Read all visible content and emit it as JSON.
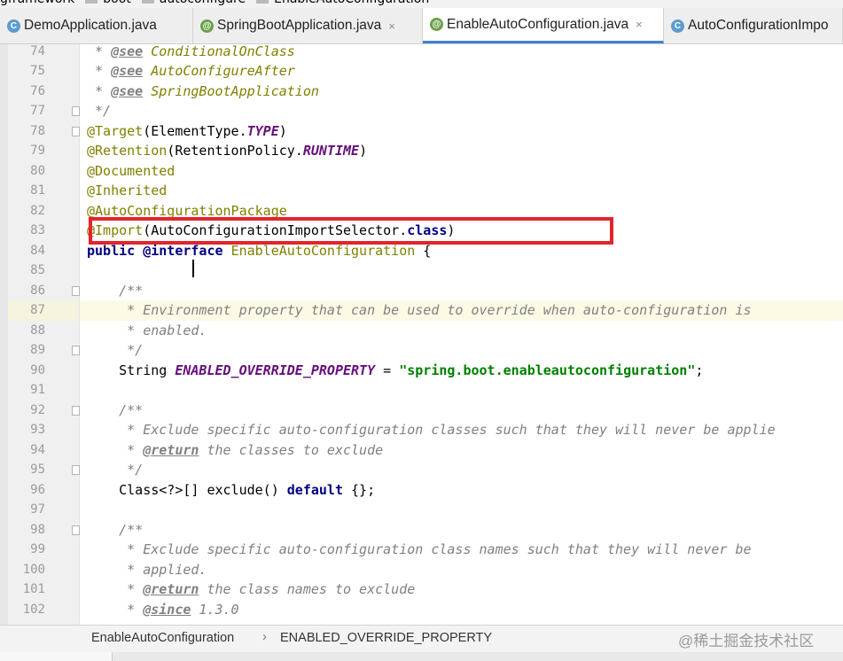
{
  "breadcrumb": {
    "items": [
      "gframework",
      "boot",
      "autoconfigure",
      "EnableAutoConfiguration"
    ]
  },
  "tabs": [
    {
      "label": "DemoApplication.java",
      "icon": "class-icon",
      "closable": false
    },
    {
      "label": "SpringBootApplication.java",
      "icon": "annotation-icon",
      "closable": true
    },
    {
      "label": "EnableAutoConfiguration.java",
      "icon": "annotation-icon",
      "closable": true,
      "active": true
    },
    {
      "label": "AutoConfigurationImpo",
      "icon": "class-icon",
      "closable": false
    }
  ],
  "tab_close_glyph": "×",
  "code_lines": [
    {
      "num": "74",
      "tokens": [
        {
          "t": " * ",
          "s": "c"
        },
        {
          "t": "@see",
          "s": "tag"
        },
        {
          "t": " ",
          "s": "c"
        },
        {
          "t": "ConditionalOnClass",
          "s": "ref"
        }
      ]
    },
    {
      "num": "75",
      "tokens": [
        {
          "t": " * ",
          "s": "c"
        },
        {
          "t": "@see",
          "s": "tag"
        },
        {
          "t": " ",
          "s": "c"
        },
        {
          "t": "AutoConfigureAfter",
          "s": "ref"
        }
      ]
    },
    {
      "num": "76",
      "tokens": [
        {
          "t": " * ",
          "s": "c"
        },
        {
          "t": "@see",
          "s": "tag"
        },
        {
          "t": " ",
          "s": "c"
        },
        {
          "t": "SpringBootApplication",
          "s": "ref"
        }
      ]
    },
    {
      "num": "77",
      "fold": true,
      "tokens": [
        {
          "t": " */",
          "s": "c"
        }
      ]
    },
    {
      "num": "78",
      "fold": true,
      "tokens": [
        {
          "t": "@Target",
          "s": "an"
        },
        {
          "t": "(ElementType.",
          "s": "pl"
        },
        {
          "t": "TYPE",
          "s": "st"
        },
        {
          "t": ")",
          "s": "pl"
        }
      ]
    },
    {
      "num": "79",
      "tokens": [
        {
          "t": "@Retention",
          "s": "an"
        },
        {
          "t": "(RetentionPolicy.",
          "s": "pl"
        },
        {
          "t": "RUNTIME",
          "s": "st"
        },
        {
          "t": ")",
          "s": "pl"
        }
      ]
    },
    {
      "num": "80",
      "tokens": [
        {
          "t": "@Documented",
          "s": "an"
        }
      ]
    },
    {
      "num": "81",
      "tokens": [
        {
          "t": "@Inherited",
          "s": "an"
        }
      ]
    },
    {
      "num": "82",
      "tokens": [
        {
          "t": "@AutoConfigurationPackage",
          "s": "an"
        }
      ]
    },
    {
      "num": "83",
      "tokens": [
        {
          "t": "@Import",
          "s": "an"
        },
        {
          "t": "(AutoConfigurationImportSelector.",
          "s": "pl"
        },
        {
          "t": "class",
          "s": "kw"
        },
        {
          "t": ")",
          "s": "pl"
        }
      ]
    },
    {
      "num": "84",
      "tokens": [
        {
          "t": "public",
          "s": "kw"
        },
        {
          "t": " ",
          "s": "pl"
        },
        {
          "t": "@interface",
          "s": "kw"
        },
        {
          "t": " ",
          "s": "pl"
        },
        {
          "t": "EnableAutoConfiguration",
          "s": "an"
        },
        {
          "t": " {",
          "s": "pl"
        }
      ]
    },
    {
      "num": "85",
      "tokens": []
    },
    {
      "num": "86",
      "fold": true,
      "tokens": [
        {
          "t": "    /**",
          "s": "c"
        }
      ]
    },
    {
      "num": "87",
      "current": true,
      "tokens": [
        {
          "t": "     * Environment property that can be used to override when auto-configuration is",
          "s": "c"
        }
      ]
    },
    {
      "num": "88",
      "tokens": [
        {
          "t": "     * enabled.",
          "s": "c"
        }
      ]
    },
    {
      "num": "89",
      "fold": true,
      "tokens": [
        {
          "t": "     */",
          "s": "c"
        }
      ]
    },
    {
      "num": "90",
      "tokens": [
        {
          "t": "    String ",
          "s": "pl"
        },
        {
          "t": "ENABLED_OVERRIDE_PROPERTY",
          "s": "st"
        },
        {
          "t": " = ",
          "s": "pl"
        },
        {
          "t": "\"spring.boot.enableautoconfiguration\"",
          "s": "ss"
        },
        {
          "t": ";",
          "s": "pl"
        }
      ]
    },
    {
      "num": "91",
      "tokens": []
    },
    {
      "num": "92",
      "fold": true,
      "tokens": [
        {
          "t": "    /**",
          "s": "c"
        }
      ]
    },
    {
      "num": "93",
      "tokens": [
        {
          "t": "     * Exclude specific auto-configuration classes such that they will never be applie",
          "s": "c"
        }
      ]
    },
    {
      "num": "94",
      "tokens": [
        {
          "t": "     * ",
          "s": "c"
        },
        {
          "t": "@return",
          "s": "tag"
        },
        {
          "t": " the classes to exclude",
          "s": "c"
        }
      ]
    },
    {
      "num": "95",
      "fold": true,
      "tokens": [
        {
          "t": "     */",
          "s": "c"
        }
      ]
    },
    {
      "num": "96",
      "tokens": [
        {
          "t": "    Class<?>[] exclude() ",
          "s": "pl"
        },
        {
          "t": "default",
          "s": "kw"
        },
        {
          "t": " {};",
          "s": "pl"
        }
      ]
    },
    {
      "num": "97",
      "tokens": []
    },
    {
      "num": "98",
      "fold": true,
      "tokens": [
        {
          "t": "    /**",
          "s": "c"
        }
      ]
    },
    {
      "num": "99",
      "tokens": [
        {
          "t": "     * Exclude specific auto-configuration class names such that they will never be",
          "s": "c"
        }
      ]
    },
    {
      "num": "100",
      "tokens": [
        {
          "t": "     * applied.",
          "s": "c"
        }
      ]
    },
    {
      "num": "101",
      "tokens": [
        {
          "t": "     * ",
          "s": "c"
        },
        {
          "t": "@return",
          "s": "tag"
        },
        {
          "t": " the class names to exclude",
          "s": "c"
        }
      ]
    },
    {
      "num": "102",
      "tokens": [
        {
          "t": "     * ",
          "s": "c"
        },
        {
          "t": "@since",
          "s": "tag"
        },
        {
          "t": " 1.3.0",
          "s": "c"
        }
      ]
    }
  ],
  "status": {
    "crumb1": "EnableAutoConfiguration",
    "separator": "›",
    "crumb2": "ENABLED_OVERRIDE_PROPERTY"
  },
  "watermark": "@稀土掘金技术社区",
  "colors": {
    "highlight_box": "#e3242b",
    "comment": "#808080",
    "annotation": "#808000",
    "keyword": "#000080",
    "static_field": "#660e7a",
    "string": "#008000",
    "active_tab_underline": "#4083c9",
    "current_line": "#fcfae5"
  }
}
